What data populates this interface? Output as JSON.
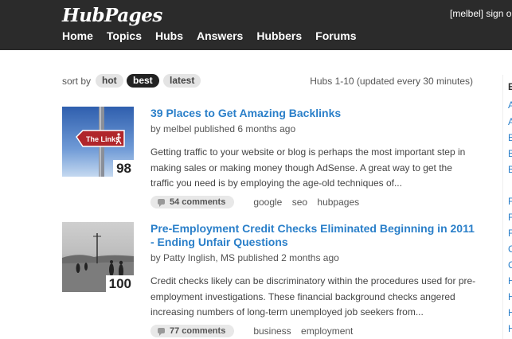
{
  "header": {
    "logo": "HubPages",
    "user_links": "[melbel] sign o",
    "nav": [
      "Home",
      "Topics",
      "Hubs",
      "Answers",
      "Hubbers",
      "Forums"
    ]
  },
  "sortbar": {
    "label": "sort by",
    "options": [
      "hot",
      "best",
      "latest"
    ],
    "active": "best",
    "count_text": "Hubs 1-10 (updated every 30 minutes)"
  },
  "hubs": [
    {
      "score": "98",
      "title": "39 Places to Get Amazing Backlinks",
      "byline": "by melbel  published 6 months ago",
      "summary": "Getting traffic to your website or blog is perhaps the most important step in making sales or making money though AdSense. A great way to get the traffic you need is by employing the age-old techniques of...",
      "comments": "54 comments",
      "tags": [
        "google",
        "seo",
        "hubpages"
      ],
      "thumb_sign_text": "The Links"
    },
    {
      "score": "100",
      "title": "Pre-Employment Credit Checks Eliminated Beginning in 2011 - Ending Unfair Questions",
      "byline": "by Patty Inglish, MS  published 2 months ago",
      "summary": "Credit checks likely can be discriminatory within the procedures used for pre-employment investigations. These financial background checks angered increasing numbers of long-term unemployed job seekers from...",
      "comments": "77 comments",
      "tags": [
        "business",
        "employment"
      ]
    }
  ],
  "right_sidebar": {
    "heading": "E",
    "letters": [
      "A",
      "A",
      "B",
      "B",
      "B",
      "F",
      "F",
      "F",
      "C",
      "C",
      "H",
      "H",
      "H",
      "H"
    ]
  },
  "colors": {
    "header_bg": "#2b2b2b",
    "link_blue": "#2a7fc9",
    "pill_active": "#222222"
  }
}
